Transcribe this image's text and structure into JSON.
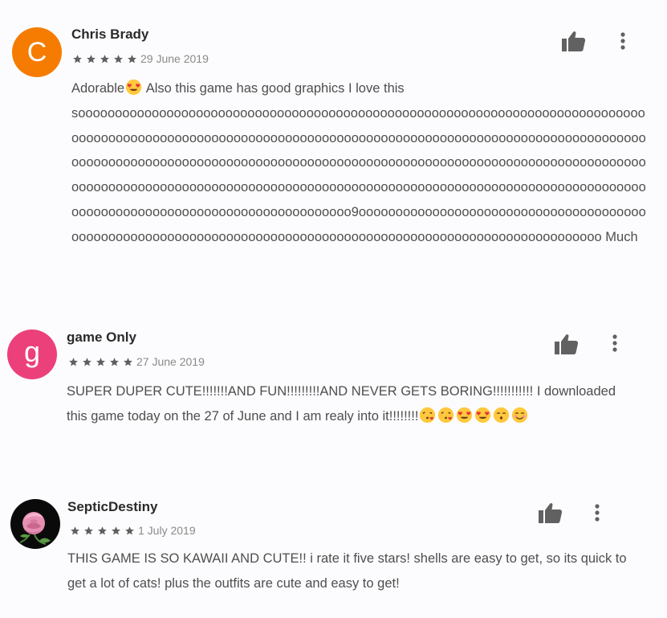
{
  "reviews": [
    {
      "avatar_letter": "C",
      "avatar_color": "#f57c00",
      "author": "Chris Brady",
      "rating": 5,
      "date": "29 June 2019",
      "text_lead": "Adorable",
      "text_after_emoji": " Also this game has good graphics I love this",
      "text_long": "sooooooooooooooooooooooooooooooooooooooooooooooooooooooooooooooooooooooooooooooooooooooooooooooooooooooooooooooooooooooooooooooooooooooooooooooooooooooooooooooooooooooooooooooooooooooooooooooooooooooooooooooooooooooooooooooooooooooooooooooooooooooooooooooooooooooooooooooooooooooooooooooooooooooooooooooooooooooooooooooooooooooooooooooooooooooooooooo9ooooooooooooooooooooooooooooooooooooooooooooooooooooooooooooooooooooooooooooooooooooooooooooooooooooooooooooooo Much"
    },
    {
      "avatar_letter": "g",
      "avatar_color": "#ec407a",
      "author": "game Only",
      "rating": 5,
      "date": "27 June 2019",
      "text": "SUPER DUPER CUTE!!!!!!!AND FUN!!!!!!!!!AND NEVER GETS BORING!!!!!!!!!!! I downloaded this game today on the 27 of June and I am realy into it!!!!!!!!"
    },
    {
      "avatar_kind": "rose",
      "author": "SepticDestiny",
      "rating": 5,
      "date": "1 July 2019",
      "text": "THIS GAME IS SO KAWAII AND CUTE!! i rate it five stars! shells are easy to get, so its quick to get a lot of cats! plus the outfits are cute and easy to get!"
    }
  ],
  "icons": {
    "thumb": "thumbs-up-icon",
    "more": "more-vert-icon",
    "star": "star-icon"
  },
  "colors": {
    "star": "#5f5f5f",
    "icon": "#616161"
  }
}
